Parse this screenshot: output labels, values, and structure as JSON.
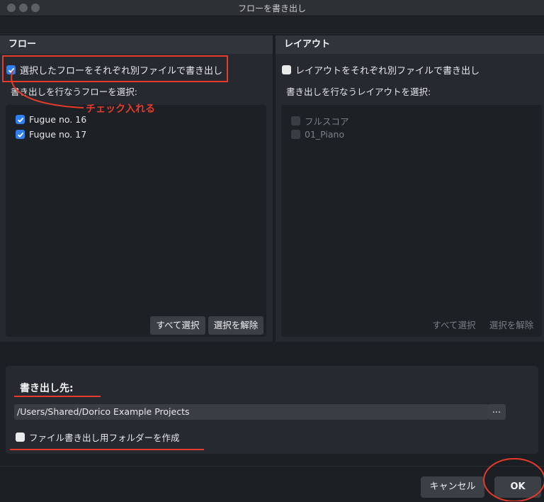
{
  "window": {
    "title": "フローを書き出し"
  },
  "flows_panel": {
    "header": "フロー",
    "separate_files_label": "選択したフローをそれぞれ別ファイルで書き出し",
    "separate_files_checked": true,
    "list_label": "書き出しを行なうフローを選択:",
    "items": [
      {
        "label": "Fugue no. 16",
        "checked": true
      },
      {
        "label": "Fugue no. 17",
        "checked": true
      }
    ],
    "select_all_label": "すべて選択",
    "deselect_label": "選択を解除"
  },
  "layouts_panel": {
    "header": "レイアウト",
    "separate_files_label": "レイアウトをそれぞれ別ファイルで書き出し",
    "separate_files_checked": false,
    "list_label": "書き出しを行なうレイアウトを選択:",
    "items": [
      {
        "label": "フルスコア",
        "checked": false
      },
      {
        "label": "01_Piano",
        "checked": false
      }
    ],
    "select_all_label": "すべて選択",
    "deselect_label": "選択を解除"
  },
  "destination": {
    "label": "書き出し先:",
    "path": "/Users/Shared/Dorico Example Projects",
    "browse_label": "...",
    "create_folder_label": "ファイル書き出し用フォルダーを作成",
    "create_folder_checked": false
  },
  "footer": {
    "cancel_label": "キャンセル",
    "ok_label": "OK"
  },
  "annotation": {
    "note": "チェック入れる",
    "color": "#e63a2b"
  }
}
